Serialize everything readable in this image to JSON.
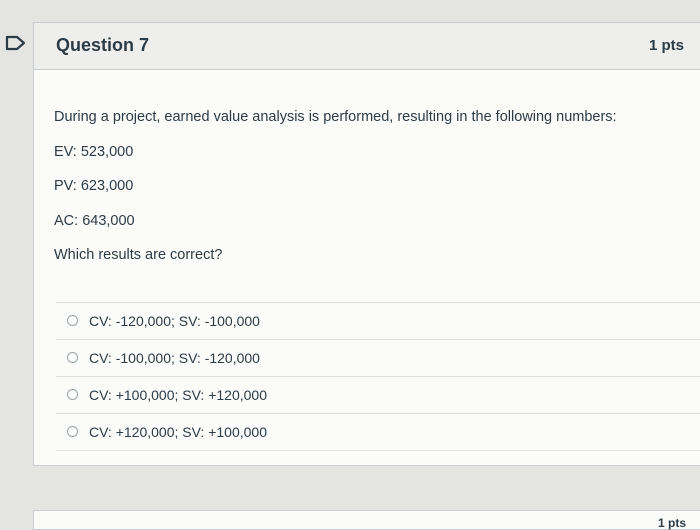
{
  "question": {
    "title": "Question 7",
    "points": "1 pts",
    "body": [
      "During a project, earned value analysis is performed, resulting in the following numbers:",
      "EV: 523,000",
      "PV: 623,000",
      "AC: 643,000",
      "Which results are correct?"
    ],
    "answers": [
      "CV: -120,000; SV: -100,000",
      "CV: -100,000; SV: -120,000",
      "CV: +100,000; SV: +120,000",
      "CV: +120,000; SV: +100,000"
    ]
  },
  "next_question": {
    "points": "1 pts"
  },
  "icons": {
    "flag": "flag-outline-icon"
  },
  "colors": {
    "text": "#2d3b45",
    "header_bg": "#eeeeed",
    "border": "#c7cdd1"
  }
}
